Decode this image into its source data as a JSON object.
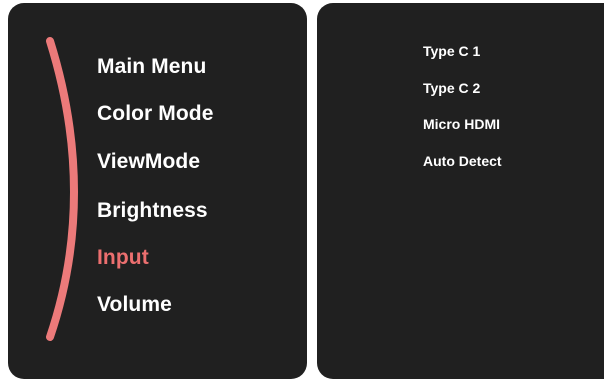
{
  "colors": {
    "panel_bg": "#202020",
    "text": "#ffffff",
    "accent": "#ec6f6f"
  },
  "main_menu": {
    "items": [
      {
        "label": "Main Menu"
      },
      {
        "label": "Color Mode"
      },
      {
        "label": "ViewMode"
      },
      {
        "label": "Brightness"
      },
      {
        "label": "Input",
        "selected": true
      },
      {
        "label": "Volume"
      }
    ]
  },
  "submenu": {
    "items": [
      {
        "label": "Type C 1"
      },
      {
        "label": "Type C 2"
      },
      {
        "label": "Micro HDMI"
      },
      {
        "label": "Auto Detect"
      }
    ]
  }
}
